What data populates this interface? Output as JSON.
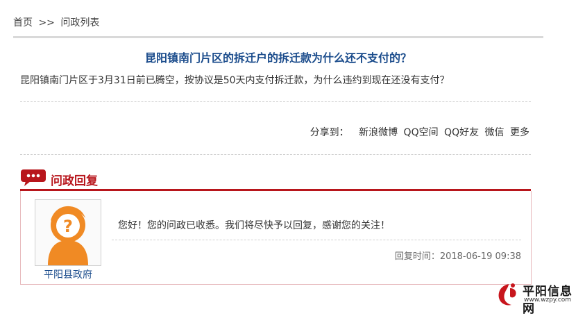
{
  "breadcrumb": {
    "home": "首页",
    "separator": ">>",
    "current": "问政列表"
  },
  "question": {
    "title": "昆阳镇南门片区的拆迁户的拆迁款为什么还不支付的？",
    "body": "昆阳镇南门片区于3月31日前已腾空，按协议是50天内支付拆迁款，为什么违约到现在还没有支付？"
  },
  "share": {
    "label": "分享到：",
    "links": [
      "新浪微博",
      "QQ空间",
      "QQ好友",
      "微信",
      "更多"
    ]
  },
  "reply": {
    "section_title": "问政回复",
    "avatar_name": "平阳县政府",
    "text": "您好！您的问政已收悉。我们将尽快予以回复，感谢您的关注！",
    "time": "回复时间：2018-06-19 09:38"
  },
  "watermark": {
    "name": "平阳信息网",
    "url": "www.wzpy.com"
  },
  "colors": {
    "title_blue": "#1b4c8c",
    "accent_red": "#b8161c",
    "avatar_orange": "#f08a24"
  },
  "icons": {
    "reply_bubble": "chat-bubble-icon",
    "avatar": "question-person-icon"
  }
}
